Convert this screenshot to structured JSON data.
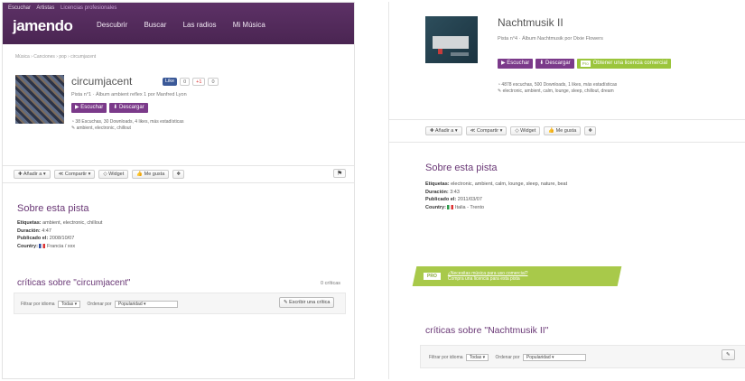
{
  "left": {
    "toplinks": [
      "Escuchar",
      "Artistas",
      "Licencias profesionales"
    ],
    "logo": "jamendo",
    "nav": [
      "Descubrir",
      "Buscar",
      "Las radios",
      "Mi Música"
    ],
    "breadcrumb": "Música › Canciones › pop › circumjacent",
    "title": "circumjacent",
    "social": {
      "like": "Like",
      "count": "0",
      "gplus": "+1",
      "gcount": "0"
    },
    "meta_line": "Pista n°1 · Álbum ambient reflex 1 por Manfred Lyon",
    "listen_button": "Escuchar",
    "download_button": "Descargar",
    "stats_line": "38 Escuchas, 30 Downloads, 4 likes, más estadísticas",
    "tags_line": "ambient, electronic, chillout",
    "actions": {
      "add": "Añadir a ▾",
      "share": "Compartir ▾",
      "widget": "Widget",
      "like": "Me gusta",
      "more": "❖"
    },
    "flag_button": "⚑",
    "about_title": "Sobre esta pista",
    "labels": {
      "tags": "Etiquetas:",
      "duration": "Duración:",
      "published": "Publicado el:",
      "country": "Country:"
    },
    "tags_value": "ambient, electronic, chillout",
    "duration_value": "4:47",
    "published_value": "2008/10/07",
    "country_value": "Francia / xxx",
    "reviews_title": "críticas sobre \"circumjacent\"",
    "reviews_count": "0 críticas",
    "filter_label": "Filtrar por idioma",
    "filter_value": "Todas ▾",
    "sort_label": "Ordenar por",
    "sort_value": "Popularidad ▾",
    "write_review": "Escribir una crítica"
  },
  "right": {
    "title": "Nachtmusik II",
    "meta_line": "Pista n°4 · Álbum Nachtmusik por Dixie Flowers",
    "listen_button": "Escuchar",
    "download_button": "Descargar",
    "license_tag": "Pro",
    "license_button": "Obtener una licencia comercial",
    "stats_line": "4878 escuchas, 500 Downloads, 1 likes, más estadísticas",
    "tags_line": "electronic, ambient, calm, lounge, sleep, chillout, dream",
    "actions": {
      "add": "Añadir a ▾",
      "share": "Compartir ▾",
      "widget": "Widget",
      "like": "Me gusta",
      "more": "❖"
    },
    "about_title": "Sobre esta pista",
    "labels": {
      "tags": "Etiquetas:",
      "duration": "Duración:",
      "published": "Publicado el:",
      "country": "Country:"
    },
    "tags_value": "electronic, ambient, calm, lounge, sleep, nature, beat",
    "duration_value": "3:43",
    "published_value": "2011/03/07",
    "country_value": "Italia - Trento",
    "promo_tag": "PRO",
    "promo_line1": "¿Necesitas música para uso comercial?",
    "promo_line2": "Compra una licencia para esta pista",
    "reviews_title": "críticas sobre \"Nachtmusik II\"",
    "filter_label": "Filtrar por idioma",
    "filter_value": "Todas ▾",
    "sort_label": "Ordenar por",
    "sort_value": "Popularidad ▾",
    "write_label": "✎"
  },
  "colors": {
    "brand": "#5d3166",
    "button": "#7b3a8a",
    "pro_green": "#9bc53c",
    "heading": "#6a3876"
  }
}
